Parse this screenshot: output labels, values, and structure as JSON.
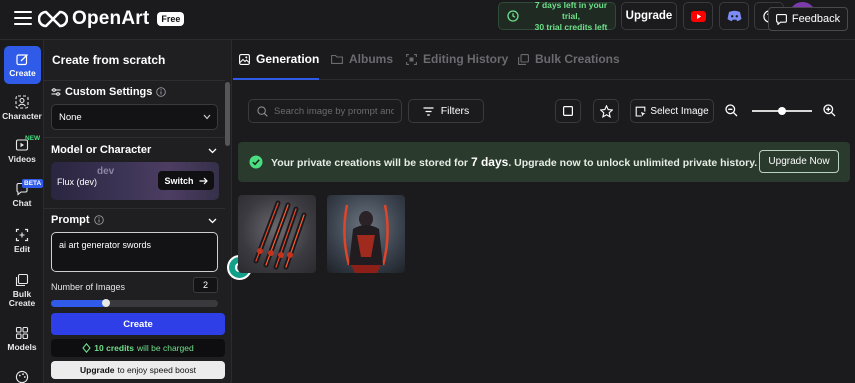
{
  "topbar": {
    "brand": "OpenArt",
    "plan_badge": "Free",
    "trial_line1": "7 days left in your trial,",
    "trial_line2": "30 trial credits left",
    "upgrade_label": "Upgrade",
    "avatar_initial": "S"
  },
  "sidebar": {
    "items": [
      {
        "label": "Create",
        "icon": "create-icon"
      },
      {
        "label": "Character",
        "icon": "character-icon"
      },
      {
        "label": "Videos",
        "icon": "video-icon",
        "badge": "NEW"
      },
      {
        "label": "Chat",
        "icon": "chat-icon",
        "badge": "BETA"
      },
      {
        "label": "Edit",
        "icon": "edit-icon"
      },
      {
        "label": "Bulk Create",
        "label_line1": "Bulk",
        "label_line2": "Create",
        "icon": "bulk-create-icon"
      },
      {
        "label": "Models",
        "icon": "models-icon"
      },
      {
        "label": "",
        "icon": "palette-icon"
      }
    ]
  },
  "panel": {
    "title": "Create from scratch",
    "custom_settings_label": "Custom Settings",
    "custom_settings_value": "None",
    "model_label": "Model or Character",
    "model_art_text": "dev",
    "model_name": "Flux (dev)",
    "switch_label": "Switch",
    "prompt_label": "Prompt",
    "prompt_value": "ai art generator swords",
    "num_images_label": "Number of Images",
    "num_images_value": "2",
    "num_images_fraction": 0.33,
    "create_label": "Create",
    "credits_amount": "10 credits",
    "credits_rest": "will be charged",
    "speed_upgrade": "Upgrade",
    "speed_rest": "to enjoy speed boost"
  },
  "tabs": [
    {
      "label": "Generation",
      "icon": "image-icon",
      "active": true
    },
    {
      "label": "Albums",
      "icon": "folder-icon",
      "active": false
    },
    {
      "label": "Editing History",
      "icon": "history-icon",
      "active": false
    },
    {
      "label": "Bulk Creations",
      "icon": "bulk-icon",
      "active": false
    }
  ],
  "feedback_label": "Feedback",
  "toolbar": {
    "search_placeholder": "Search image by prompt and",
    "filters_label": "Filters",
    "select_image_label": "Select Image",
    "zoom_fraction": 0.5
  },
  "banner": {
    "text_pre": "Your private creations will be stored for",
    "days": "7 days",
    "text_post": ". Upgrade now to unlock unlimited private history.",
    "button": "Upgrade Now"
  },
  "colors": {
    "accent": "#2f5be8",
    "create_button": "#2f3fe8",
    "trial_green": "#6fe08a",
    "banner_bg": "#2a3a2c",
    "avatar": "#7c3aad"
  }
}
